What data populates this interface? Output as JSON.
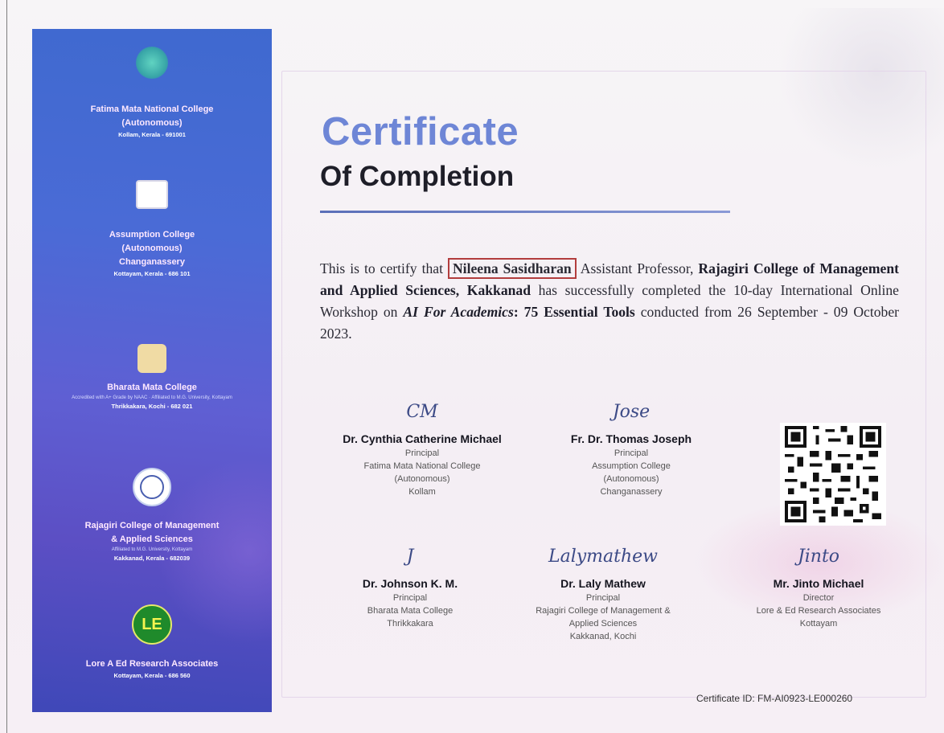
{
  "sidebar": {
    "institutions": [
      {
        "name_lines": [
          "Fatima Mata National College",
          "(Autonomous)"
        ],
        "sub": "",
        "location": "Kollam, Kerala - 691001"
      },
      {
        "name_lines": [
          "Assumption College",
          "(Autonomous)",
          "Changanassery"
        ],
        "sub": "",
        "location": "Kottayam, Kerala - 686 101"
      },
      {
        "name_lines": [
          "Bharata Mata College"
        ],
        "sub": "Accredited with A+ Grade by NAAC · Affiliated to M.G. University, Kottayam",
        "location": "Thrikkakara, Kochi - 682 021"
      },
      {
        "name_lines": [
          "Rajagiri College of Management",
          "& Applied Sciences"
        ],
        "sub": "Affiliated to M.G. University, Kottayam",
        "location": "Kakkanad, Kerala - 682039"
      },
      {
        "name_lines": [
          "Lore A Ed Research Associates"
        ],
        "sub": "",
        "location": "Kottayam, Kerala - 686 560"
      }
    ],
    "le_mark": "LE"
  },
  "title": {
    "main": "Certificate",
    "sub": "Of Completion"
  },
  "body": {
    "lead": "This is to certify that ",
    "recipient": "Nileena Sasidharan",
    "role": " Assistant Professor, ",
    "org": "Rajagiri College of Management and Applied Sciences, Kakkanad",
    "mid": " has successfully completed the 10-day International Online Workshop on ",
    "workshop_italic": "AI For Academics",
    "workshop_rest": ": 75 Essential Tools",
    "tail": " conducted from 26 September - 09 October 2023."
  },
  "signatories": [
    {
      "name": "Dr. Cynthia Catherine Michael",
      "title": "Principal",
      "lines": [
        "Fatima Mata National College",
        "(Autonomous)",
        "Kollam"
      ],
      "sig": "CM"
    },
    {
      "name": "Fr. Dr. Thomas Joseph",
      "title": "Principal",
      "lines": [
        "Assumption College",
        "(Autonomous)",
        "Changanassery"
      ],
      "sig": "Jose"
    },
    {
      "name": "Dr. Johnson K. M.",
      "title": "Principal",
      "lines": [
        "Bharata Mata College",
        "Thrikkakara"
      ],
      "sig": "J"
    },
    {
      "name": "Dr. Laly Mathew",
      "title": "Principal",
      "lines": [
        "Rajagiri College of Management &",
        "Applied Sciences",
        "Kakkanad, Kochi"
      ],
      "sig": "Lalymathew"
    },
    {
      "name": "Mr. Jinto Michael",
      "title": "Director",
      "lines": [
        "Lore & Ed Research Associates",
        "Kottayam"
      ],
      "sig": "Jinto"
    }
  ],
  "certificate_id": "Certificate ID: FM-AI0923-LE000260",
  "colors": {
    "title_blue": "#6e86d6",
    "sidebar_top": "#3f69cf",
    "sidebar_bottom": "#3f48b8",
    "name_box": "#b23d3d"
  }
}
